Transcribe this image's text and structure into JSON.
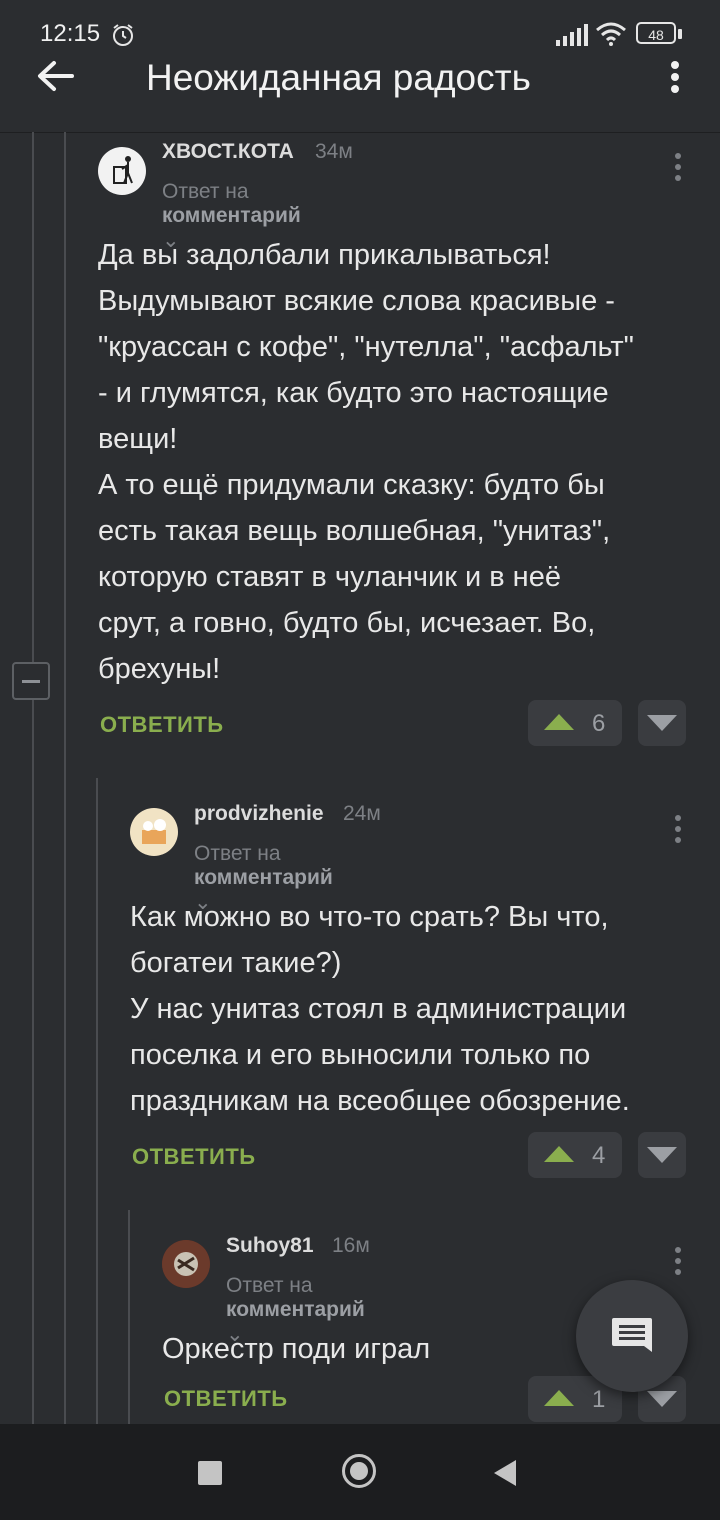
{
  "status_bar": {
    "time": "12:15",
    "battery": "48"
  },
  "header": {
    "title": "Неожиданная радость"
  },
  "comments": [
    {
      "author": "ХВОСТ.КОТА",
      "time": "34м",
      "reply_prefix": "Ответ на",
      "reply_target": "комментарий",
      "text": "Да вы задолбали прикалываться!\nВыдумывают всякие слова красивые -\n\"круассан с кофе\", \"нутелла\", \"асфальт\"\n- и глумятся, как будто это настоящие\nвещи!\nА то ещё придумали сказку: будто бы\nесть такая вещь волшебная, \"унитаз\",\nкоторую ставят в чуланчик и в неё\nсрут, а говно, будто бы, исчезает. Во,\nбрехуны!",
      "reply_label": "ОТВЕТИТЬ",
      "rating": "6"
    },
    {
      "author": "prodvizhenie",
      "time": "24м",
      "reply_prefix": "Ответ на",
      "reply_target": "комментарий",
      "text": "Как можно во что-то срать? Вы что,\nбогатеи такие?)\nУ нас унитаз стоял в администрации\nпоселка и его выносили только по\nпраздникам на всеобщее обозрение.",
      "reply_label": "ОТВЕТИТЬ",
      "rating": "4"
    },
    {
      "author": "Suhoy81",
      "time": "16м",
      "reply_prefix": "Ответ на",
      "reply_target": "комментарий",
      "text": "Оркестр поди играл",
      "reply_label": "ОТВЕТИТЬ",
      "rating": "1"
    }
  ],
  "icons": {
    "back": "arrow-left-icon",
    "menu": "more-vertical-icon",
    "fab": "comment-icon"
  },
  "colors": {
    "background": "#2b2d30",
    "accent": "#8aae4e"
  }
}
